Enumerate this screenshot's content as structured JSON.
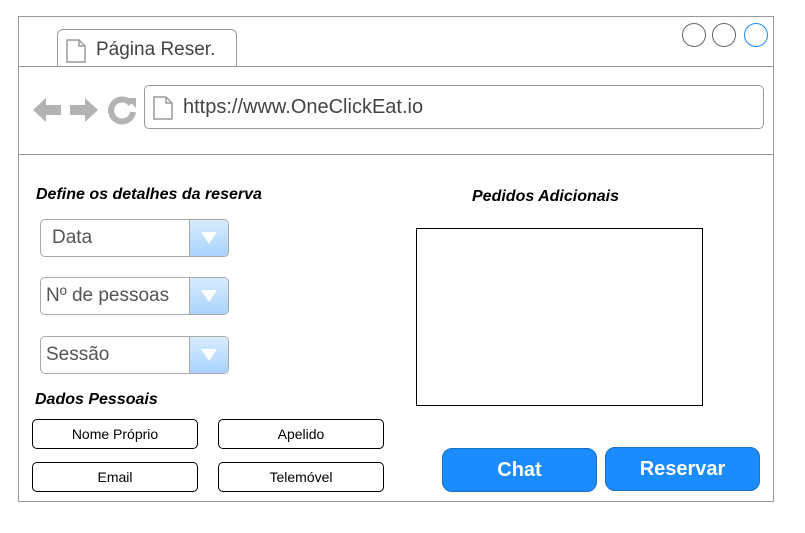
{
  "browser": {
    "tab_title": "Página Reser.",
    "url": "https://www.OneClickEat.io",
    "window_buttons": [
      "minimize",
      "maximize",
      "close"
    ],
    "nav_icons": [
      "back-arrow-icon",
      "forward-arrow-icon",
      "reload-icon"
    ],
    "colors": {
      "accent": "#1a8cff",
      "nav_icon_gray": "#b3b3b3"
    }
  },
  "reservation": {
    "heading": "Define os detalhes da reserva",
    "selects": [
      {
        "label": "Data"
      },
      {
        "label": "Nº de pessoas"
      },
      {
        "label": "Sessão"
      }
    ]
  },
  "personal": {
    "heading": "Dados Pessoais",
    "fields": [
      "Nome Próprio",
      "Apelido",
      "Email",
      "Telemóvel"
    ]
  },
  "additional": {
    "heading": "Pedidos Adicionais",
    "text": ""
  },
  "actions": {
    "chat_label": "Chat",
    "reserve_label": "Reservar"
  }
}
